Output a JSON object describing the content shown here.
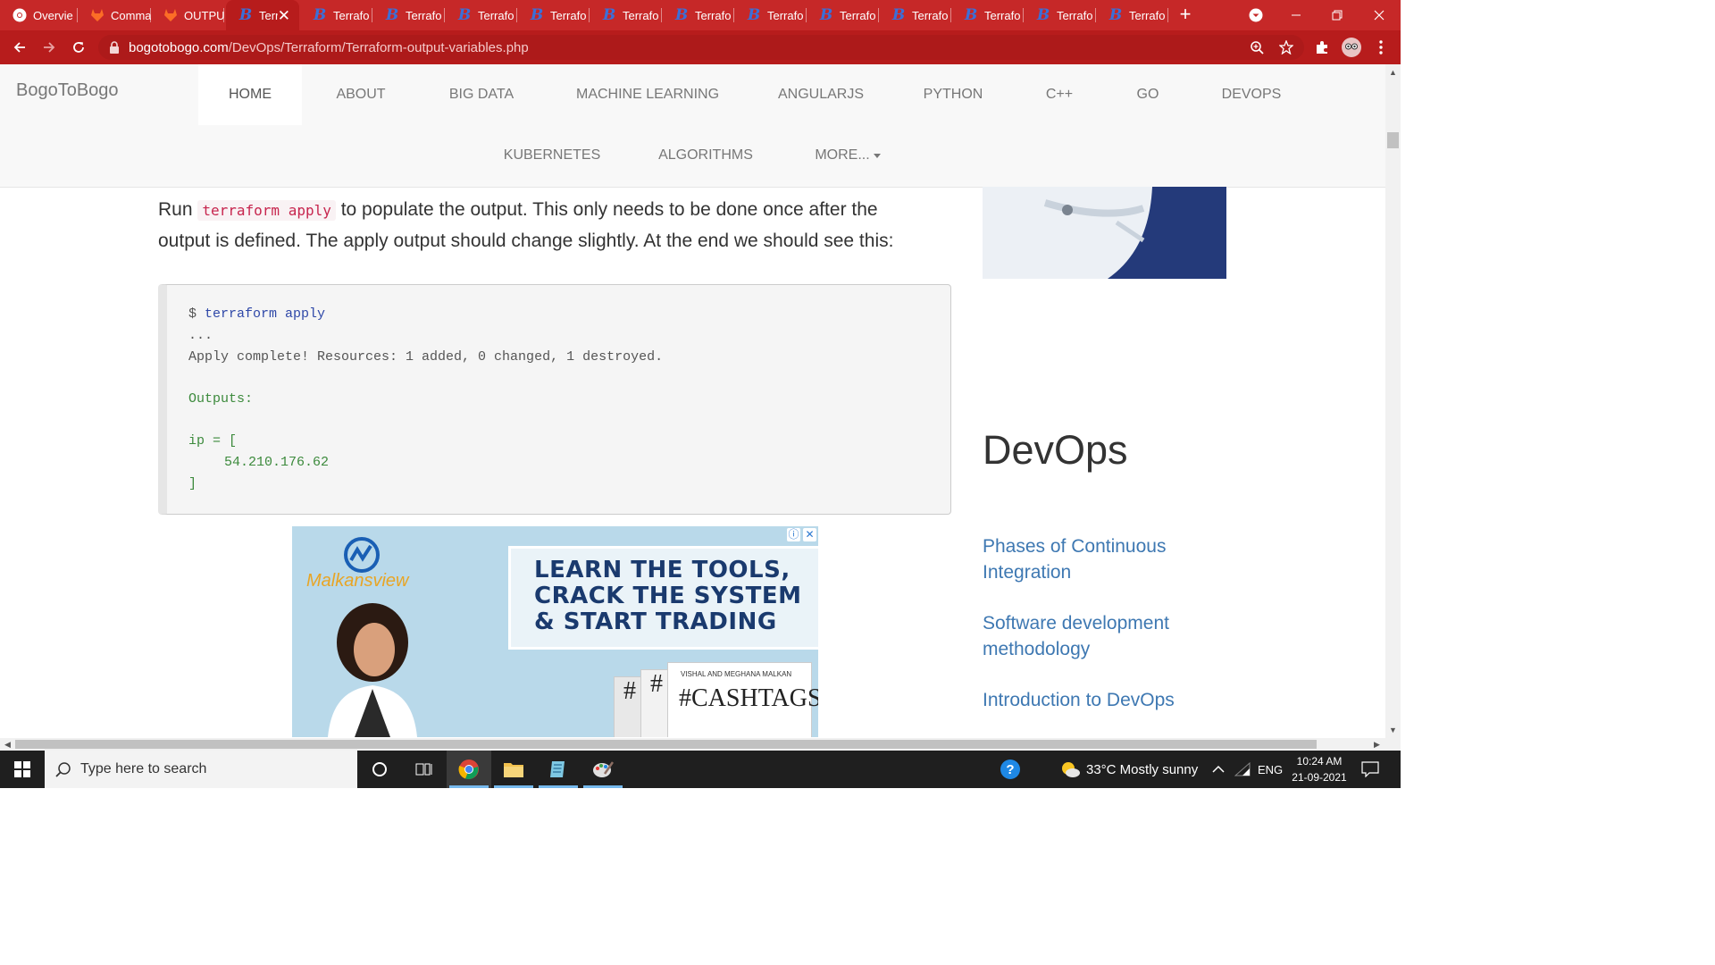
{
  "browser": {
    "tabs": [
      {
        "title": "Overvie",
        "icon": "chrome-icon"
      },
      {
        "title": "Comma",
        "icon": "gitlab-icon"
      },
      {
        "title": "OUTPU",
        "icon": "gitlab-icon"
      },
      {
        "title": "Terr",
        "icon": "bogotobogo-icon",
        "active": true
      },
      {
        "title": "Terrafo",
        "icon": "bogotobogo-icon"
      },
      {
        "title": "Terrafo",
        "icon": "bogotobogo-icon"
      },
      {
        "title": "Terrafo",
        "icon": "bogotobogo-icon"
      },
      {
        "title": "Terrafo",
        "icon": "bogotobogo-icon"
      },
      {
        "title": "Terrafo",
        "icon": "bogotobogo-icon"
      },
      {
        "title": "Terrafo",
        "icon": "bogotobogo-icon"
      },
      {
        "title": "Terrafo",
        "icon": "bogotobogo-icon"
      },
      {
        "title": "Terrafo",
        "icon": "bogotobogo-icon"
      },
      {
        "title": "Terrafo",
        "icon": "bogotobogo-icon"
      },
      {
        "title": "Terrafo",
        "icon": "bogotobogo-icon"
      },
      {
        "title": "Terrafo",
        "icon": "bogotobogo-icon"
      },
      {
        "title": "Terrafo",
        "icon": "bogotobogo-icon"
      }
    ],
    "url_host": "bogotobogo.com",
    "url_path": "/DevOps/Terraform/Terraform-output-variables.php",
    "accent": "#c62828"
  },
  "site": {
    "brand": "BogoToBogo",
    "nav": [
      "HOME",
      "ABOUT",
      "BIG DATA",
      "MACHINE LEARNING",
      "ANGULARJS",
      "PYTHON",
      "C++",
      "GO",
      "DEVOPS",
      "KUBERNETES",
      "ALGORITHMS",
      "MORE..."
    ]
  },
  "content": {
    "para_pre": "Run ",
    "para_code": "terraform apply",
    "para_line1": " to populate the output. This only needs to be done once after the",
    "para_line2": "output is defined. The apply output should change slightly. At the end we should see this:",
    "code": {
      "prompt": "$ ",
      "command": "terraform apply",
      "ellipsis": "...",
      "result": "Apply complete! Resources: 1 added, 0 changed, 1 destroyed.",
      "outputs_label": "Outputs:",
      "ip_open": "ip = [",
      "ip_value": "54.210.176.62",
      "ip_close": "]"
    },
    "ad": {
      "brand": "Malkansview",
      "headline": "LEARN THE TOOLS, CRACK THE SYSTEM & START TRADING",
      "book_authors": "VISHAL AND MEGHANA MALKAN",
      "book_title": "#CASHTAGS",
      "hash": "#"
    }
  },
  "sidebar": {
    "heading": "DevOps",
    "links": [
      "Phases of Continuous Integration",
      "Software development methodology",
      "Introduction to DevOps"
    ]
  },
  "taskbar": {
    "search_placeholder": "Type here to search",
    "weather": "33°C  Mostly sunny",
    "lang": "ENG",
    "time": "10:24 AM",
    "date": "21-09-2021"
  }
}
